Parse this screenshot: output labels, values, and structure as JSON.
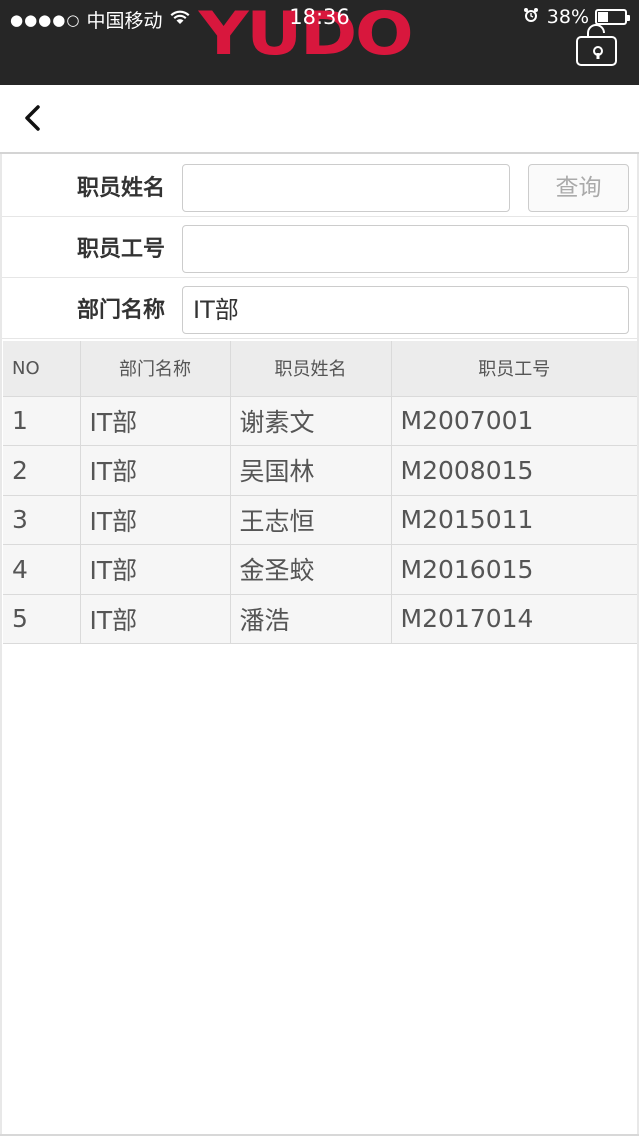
{
  "status_bar": {
    "signal": "●●●●○",
    "carrier": "中国移动",
    "time": "18:36",
    "battery_percent": "38%",
    "battery_level": 0.38
  },
  "header": {
    "logo_text": "YUDO",
    "logo_color": "#d8173d",
    "lock_icon": "unlock-icon"
  },
  "nav": {
    "back_icon": "chevron-left-icon"
  },
  "search_form": {
    "name_label": "职员姓名",
    "name_value": "",
    "id_label": "职员工号",
    "id_value": "",
    "dept_label": "部门名称",
    "dept_value": "IT部",
    "query_button": "查询"
  },
  "table": {
    "headers": [
      "NO",
      "部门名称",
      "职员姓名",
      "职员工号"
    ],
    "rows": [
      [
        "1",
        "IT部",
        "谢素文",
        "M2007001"
      ],
      [
        "2",
        "IT部",
        "吴国林",
        "M2008015"
      ],
      [
        "3",
        "IT部",
        "王志恒",
        "M2015011"
      ],
      [
        "4",
        "IT部",
        "金圣蛟",
        "M2016015"
      ],
      [
        "5",
        "IT部",
        "潘浩",
        "M2017014"
      ]
    ]
  }
}
